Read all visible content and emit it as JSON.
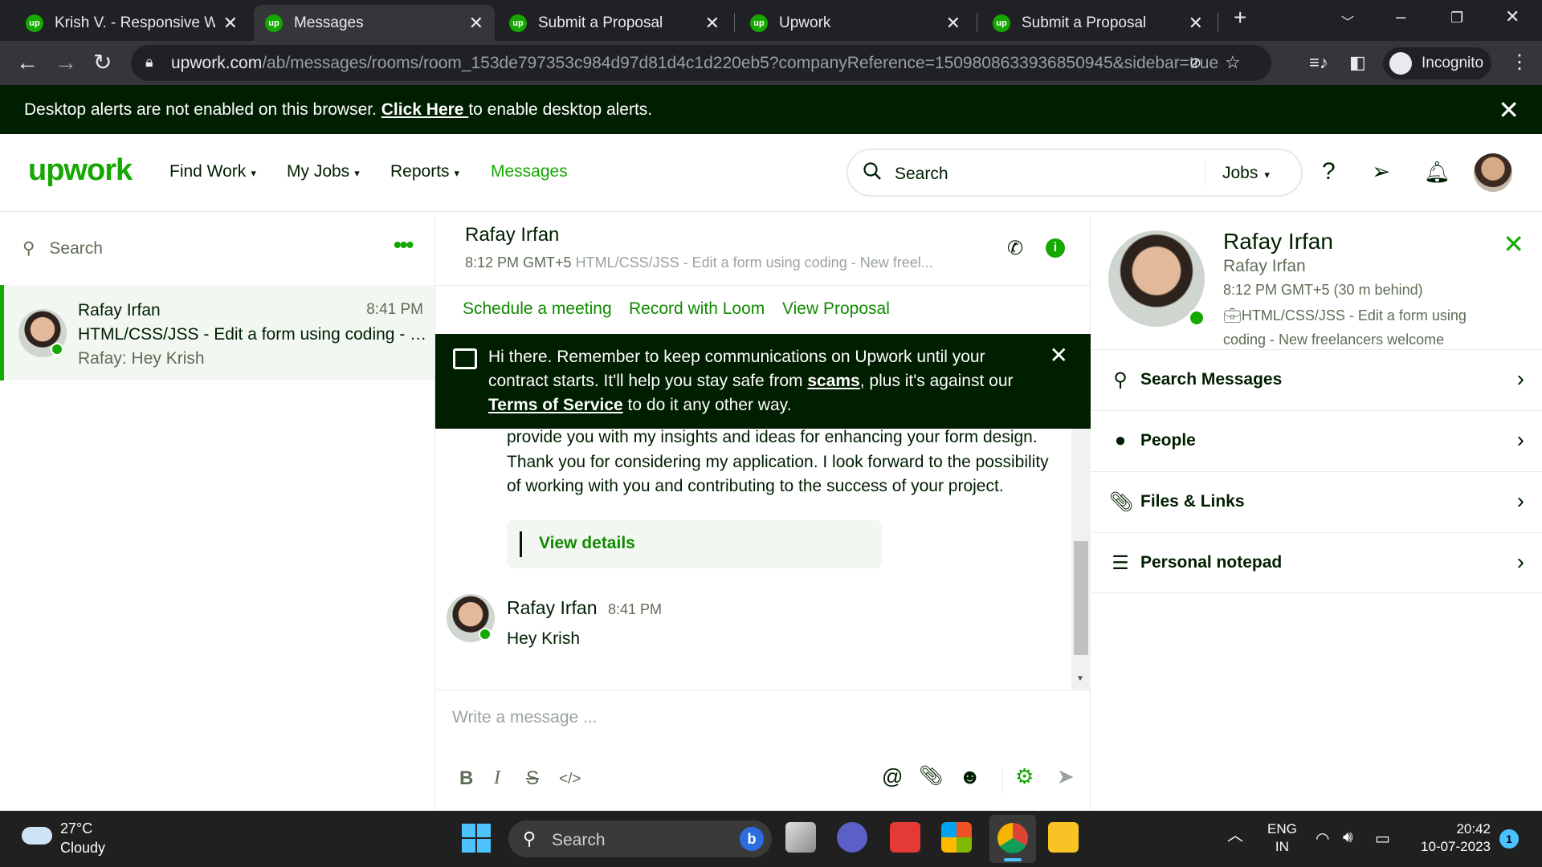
{
  "browser": {
    "tabs": [
      {
        "title": "Krish V. - Responsive Web"
      },
      {
        "title": "Messages"
      },
      {
        "title": "Submit a Proposal"
      },
      {
        "title": "Upwork"
      },
      {
        "title": "Submit a Proposal"
      }
    ],
    "active_tab": 1,
    "url_host": "upwork.com",
    "url_path": "/ab/messages/rooms/room_153de797353c984d97d81d4c1d220eb5?companyReference=1509808633936850945&sidebar=true",
    "incognito_label": "Incognito"
  },
  "alert": {
    "text_before": "Desktop alerts are not enabled on this browser. ",
    "link": "Click Here ",
    "text_after": "to enable desktop alerts."
  },
  "header": {
    "logo": "upwork",
    "nav": [
      "Find Work",
      "My Jobs",
      "Reports",
      "Messages"
    ],
    "search_placeholder": "Search",
    "search_scope": "Jobs"
  },
  "rooms": {
    "search_placeholder": "Search",
    "items": [
      {
        "name": "Rafay Irfan",
        "time": "8:41 PM",
        "job": "HTML/CSS/JSS - Edit a form using coding - New freelancers welcome",
        "last_message": "Rafay: Hey Krish"
      }
    ]
  },
  "chat": {
    "name": "Rafay Irfan",
    "time": "8:12 PM GMT+5",
    "job": "HTML/CSS/JSS - Edit a form using coding - New freel...",
    "actions": [
      "Schedule a meeting",
      "Record with Loom",
      "View Proposal"
    ],
    "warning": {
      "part1": "Hi there. Remember to keep communications on Upwork until your contract starts. It'll help you stay safe from ",
      "link1": "scams",
      "part2": ", plus it's against our ",
      "link2": "Terms of Service",
      "part3": " to do it any other way."
    },
    "proposal_text": "provide you with my insights and ideas for enhancing your form design. Thank you for considering my application. I look forward to the possibility of working with you and contributing to the success of your project.",
    "view_details": "View details",
    "messages": [
      {
        "sender": "Rafay Irfan",
        "time": "8:41 PM",
        "text": "Hey Krish"
      }
    ],
    "composer_placeholder": "Write a message ..."
  },
  "profile": {
    "name": "Rafay Irfan",
    "subtitle": "Rafay Irfan",
    "time": "8:12 PM GMT+5 (30 m behind)",
    "job": "HTML/CSS/JSS - Edit a form using coding - New freelancers welcome",
    "menu": [
      "Search Messages",
      "People",
      "Files & Links",
      "Personal notepad"
    ]
  },
  "taskbar": {
    "temp": "27°C",
    "weather": "Cloudy",
    "search": "Search",
    "lang1": "ENG",
    "lang2": "IN",
    "time": "20:42",
    "date": "10-07-2023",
    "notifications": "1"
  },
  "colors": {
    "brand": "#14a800",
    "dark": "#001e00",
    "link": "#108a00"
  }
}
